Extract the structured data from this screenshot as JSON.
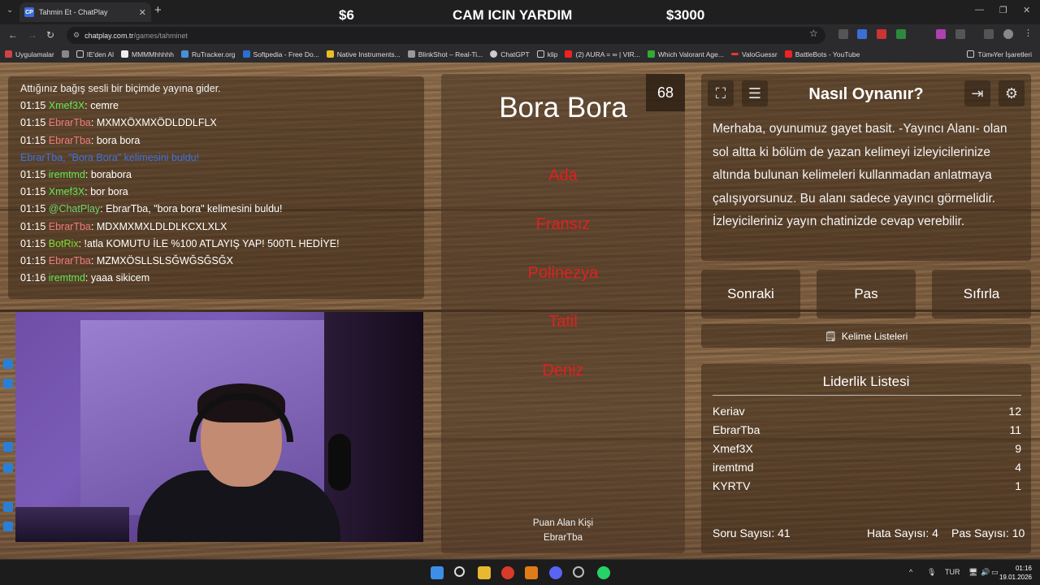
{
  "browser": {
    "tab_title": "Tahmin Et - ChatPlay",
    "tab_favicon": "CP",
    "url_host": "chatplay.com.tr",
    "url_path": "/games/tahminet",
    "overlay": {
      "left": "$6",
      "center": "CAM ICIN YARDIM",
      "right": "$3000"
    },
    "bookmarks": [
      "Uygulamalar",
      "IE'den Al",
      "MMMMhhhhh",
      "RuTracker.org",
      "Softpedia - Free Do...",
      "Native Instruments...",
      "BlinkShot – Real-Ti...",
      "ChatGPT",
      "klip",
      "(2) AURA = ∞ | VIR...",
      "Which Valorant Age...",
      "ValoGuessr",
      "BattleBots - YouTube"
    ],
    "bookmarks_right": "Tüm Yer İşaretleri"
  },
  "chat": {
    "notice": "Attığınız bağış sesli bir biçimde yayına gider.",
    "messages": [
      {
        "time": "01:15",
        "user": "Xmef3X",
        "color": "green",
        "text": "cemre"
      },
      {
        "time": "01:15",
        "user": "EbrarTba",
        "color": "red",
        "text": "MXMXÖXMXÖDLDDLFLX"
      },
      {
        "time": "01:15",
        "user": "EbrarTba",
        "color": "red",
        "text": "bora bora"
      },
      {
        "time": "",
        "user": "",
        "color": "found",
        "text": "EbrarTba, \"Bora Bora\" kelimesini buldu!"
      },
      {
        "time": "01:15",
        "user": "iremtmd",
        "color": "green",
        "text": "borabora"
      },
      {
        "time": "01:15",
        "user": "Xmef3X",
        "color": "green",
        "text": "bor bora"
      },
      {
        "time": "01:15",
        "user": "@ChatPlay",
        "color": "cp",
        "text": "EbrarTba, \"bora bora\" kelimesini buldu!"
      },
      {
        "time": "01:15",
        "user": "EbrarTba",
        "color": "red",
        "text": "MDXMXMXLDLDLKCXLXLX"
      },
      {
        "time": "01:15",
        "user": "BotRix",
        "color": "lime",
        "text": "!atla KOMUTU İLE %100 ATLAYIŞ YAP! 500TL HEDİYE!"
      },
      {
        "time": "01:15",
        "user": "EbrarTba",
        "color": "red",
        "text": "MZMXÖSLLSLSĞWĞSĞSĞX"
      },
      {
        "time": "01:16",
        "user": "iremtmd",
        "color": "green",
        "text": "yaaa sikicem"
      }
    ]
  },
  "game": {
    "timer": "68",
    "word": "Bora Bora",
    "forbidden": [
      "Ada",
      "Fransız",
      "Polinezya",
      "Tatil",
      "Deniz"
    ],
    "scorer_label": "Puan Alan Kişi",
    "scorer_name": "EbrarTba"
  },
  "howto": {
    "title": "Nasıl Oynanır?",
    "text": "Merhaba, oyunumuz gayet basit. -Yayıncı Alanı- olan sol altta ki bölüm de yazan kelimeyi izleyicilerinize altında bulunan kelimeleri kullanmadan anlatmaya çalışıyorsunuz. Bu alanı sadece yayıncı görmelidir. İzleyicileriniz yayın chatinizde cevap verebilir."
  },
  "buttons": {
    "next": "Sonraki",
    "pass": "Pas",
    "reset": "Sıfırla",
    "lists": "Kelime Listeleri"
  },
  "leaderboard": {
    "title": "Liderlik Listesi",
    "rows": [
      {
        "name": "Keriav",
        "score": "12"
      },
      {
        "name": "EbrarTba",
        "score": "11"
      },
      {
        "name": "Xmef3X",
        "score": "9"
      },
      {
        "name": "iremtmd",
        "score": "4"
      },
      {
        "name": "KYRTV",
        "score": "1"
      }
    ],
    "questions": "Soru Sayısı: 41",
    "errors": "Hata Sayısı: 4",
    "passes": "Pas Sayısı: 10"
  },
  "taskbar": {
    "lang": "TUR",
    "time": "01:16",
    "date": "19.01.2026"
  }
}
